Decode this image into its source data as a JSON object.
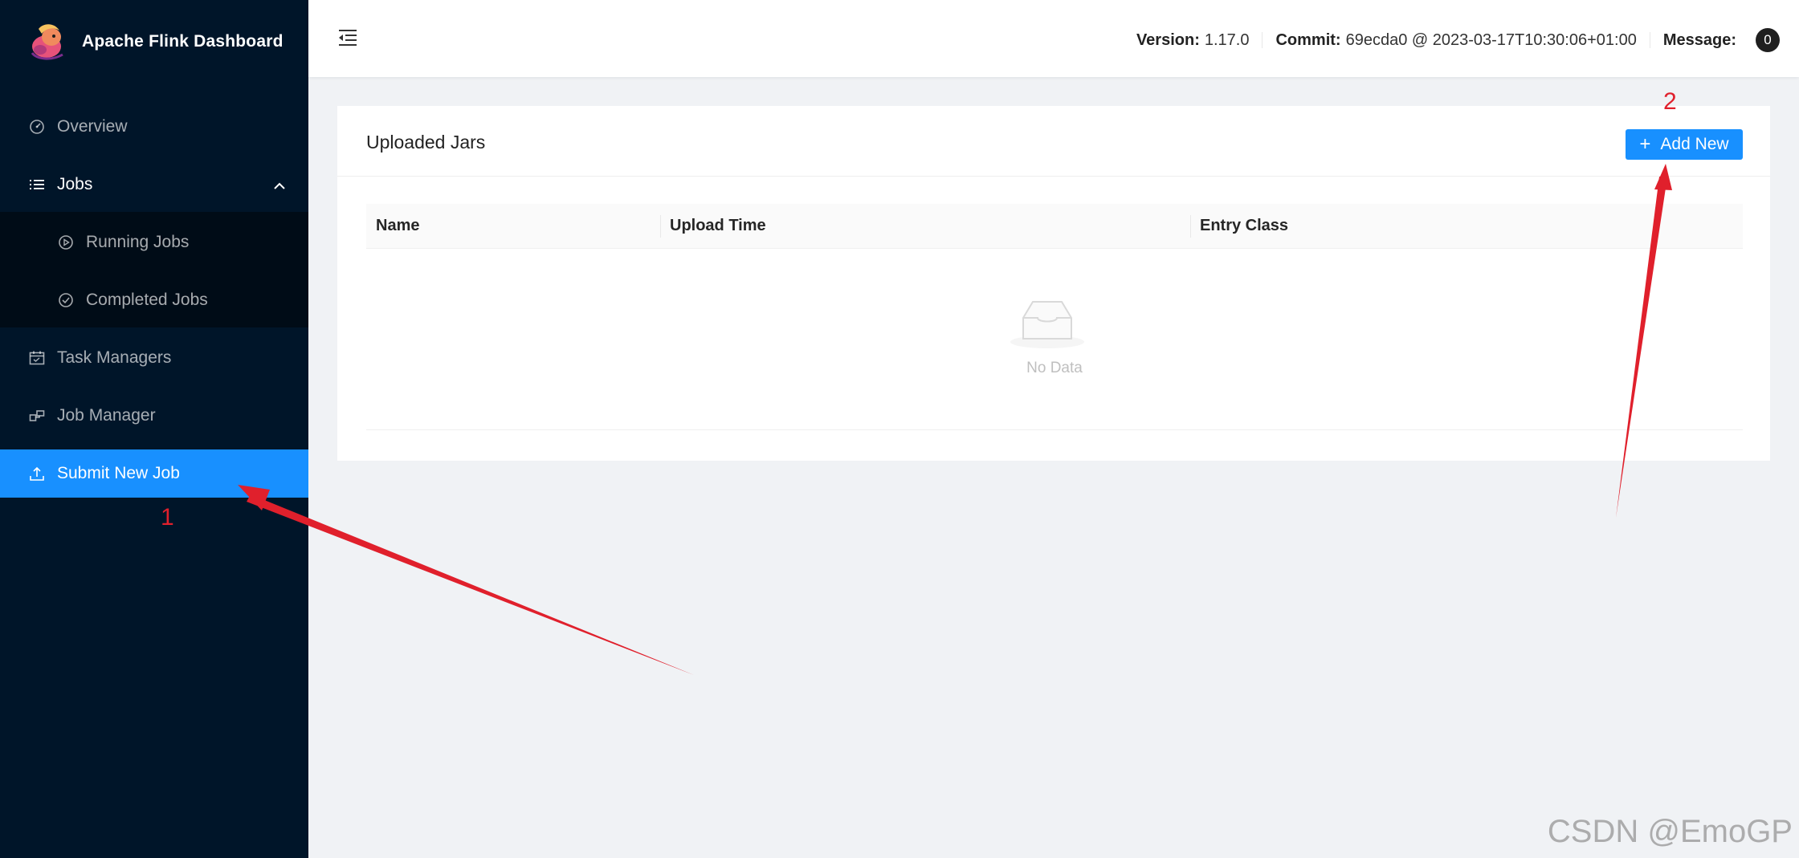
{
  "app": {
    "title": "Apache Flink Dashboard"
  },
  "sidebar": {
    "items": [
      {
        "label": "Overview",
        "icon": "dashboard-icon"
      },
      {
        "label": "Jobs",
        "icon": "list-icon"
      },
      {
        "label": "Running Jobs",
        "icon": "play-circle-icon"
      },
      {
        "label": "Completed Jobs",
        "icon": "check-circle-icon"
      },
      {
        "label": "Task Managers",
        "icon": "schedule-icon"
      },
      {
        "label": "Job Manager",
        "icon": "cluster-icon"
      },
      {
        "label": "Submit New Job",
        "icon": "upload-icon"
      }
    ],
    "active": "Submit New Job"
  },
  "header": {
    "version_label": "Version:",
    "version_value": "1.17.0",
    "commit_label": "Commit:",
    "commit_value": "69ecda0 @ 2023-03-17T10:30:06+01:00",
    "message_label": "Message:",
    "message_count": "0"
  },
  "card": {
    "title": "Uploaded Jars",
    "add_label": "Add New",
    "columns": [
      "Name",
      "Upload Time",
      "Entry Class"
    ],
    "empty_text": "No Data"
  },
  "annotations": {
    "step1": "1",
    "step2": "2"
  },
  "watermark": "CSDN @EmoGP",
  "colors": {
    "sidebar": "#001529",
    "active": "#1890ff",
    "arrow": "#e0202c"
  }
}
